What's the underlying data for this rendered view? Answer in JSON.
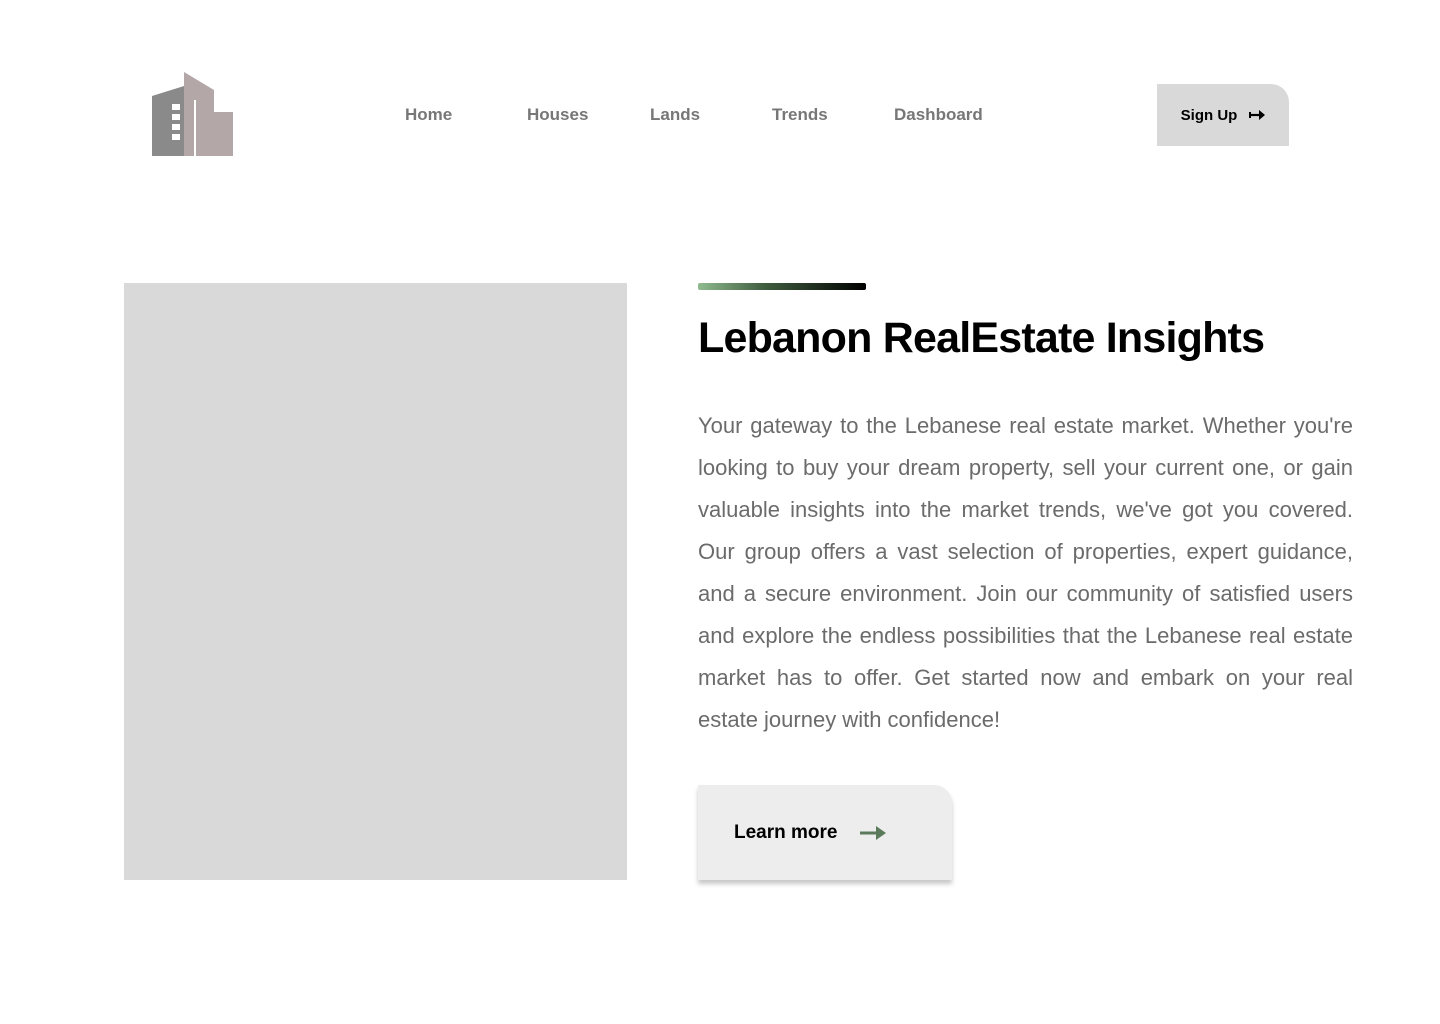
{
  "header": {
    "logo_icon": "buildings-logo-icon",
    "nav": {
      "home": "Home",
      "houses": "Houses",
      "lands": "Lands",
      "trends": "Trends",
      "dashboard": "Dashboard"
    },
    "signup": {
      "label": "Sign Up",
      "icon": "arrow-right-icon"
    }
  },
  "hero": {
    "title": "Lebanon RealEstate Insights",
    "description": "Your gateway to the Lebanese real estate market. Whether you're looking to buy your dream property, sell your current one, or gain valuable insights into the market trends, we've got you covered. Our group offers a vast selection of properties, expert guidance, and a secure environment. Join our community of satisfied users and explore the endless possibilities that the Lebanese real estate market has to offer. Get started now and embark on your real estate journey with confidence!",
    "cta": {
      "label": "Learn more",
      "icon": "arrow-right-icon"
    }
  },
  "colors": {
    "nav_text": "#777777",
    "button_bg": "#d9d9d9",
    "cta_bg": "#ededed",
    "accent_green": "#5b7a5b",
    "image_placeholder": "#d9d9d9",
    "body_text": "#6b6b6b"
  }
}
